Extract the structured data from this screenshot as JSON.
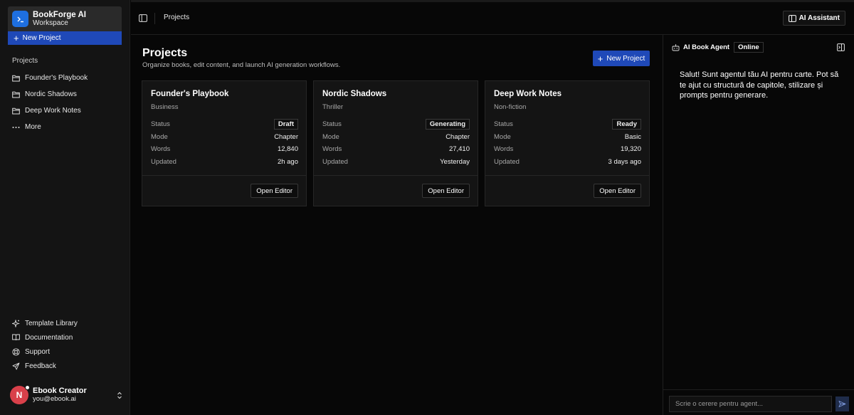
{
  "brand": {
    "title": "BookForge AI",
    "subtitle": "Workspace"
  },
  "sidebar": {
    "new_project_label": "New Project",
    "section_label": "Projects",
    "items": [
      {
        "label": "Founder's Playbook",
        "icon": "folder-icon"
      },
      {
        "label": "Nordic Shadows",
        "icon": "folder-icon"
      },
      {
        "label": "Deep Work Notes",
        "icon": "folder-icon"
      },
      {
        "label": "More",
        "icon": "more-icon"
      }
    ],
    "bottom": [
      {
        "label": "Template Library",
        "icon": "sparkle-icon"
      },
      {
        "label": "Documentation",
        "icon": "book-icon"
      },
      {
        "label": "Support",
        "icon": "lifebuoy-icon"
      },
      {
        "label": "Feedback",
        "icon": "send-icon"
      }
    ],
    "user": {
      "initial": "N",
      "name": "Ebook Creator",
      "email": "you@ebook.ai"
    }
  },
  "topbar": {
    "breadcrumb": "Projects",
    "ai_assistant_label": "AI Assistant"
  },
  "main": {
    "title": "Projects",
    "subtitle": "Organize books, edit content, and launch AI generation workflows.",
    "new_project_label": "New Project",
    "row_labels": {
      "status": "Status",
      "mode": "Mode",
      "words": "Words",
      "updated": "Updated"
    },
    "open_editor_label": "Open Editor",
    "cards": [
      {
        "title": "Founder's Playbook",
        "category": "Business",
        "status": "Draft",
        "mode": "Chapter",
        "words": "12,840",
        "updated": "2h ago"
      },
      {
        "title": "Nordic Shadows",
        "category": "Thriller",
        "status": "Generating",
        "mode": "Chapter",
        "words": "27,410",
        "updated": "Yesterday"
      },
      {
        "title": "Deep Work Notes",
        "category": "Non-fiction",
        "status": "Ready",
        "mode": "Basic",
        "words": "19,320",
        "updated": "3 days ago"
      }
    ]
  },
  "agent": {
    "title": "AI Book Agent",
    "status": "Online",
    "message": "Salut! Sunt agentul tău AI pentru carte. Pot să te ajut cu structură de capitole, stilizare și prompts pentru generare.",
    "input_placeholder": "Scrie o cerere pentru agent..."
  },
  "colors": {
    "accent": "#1f49b8",
    "brand_logo": "#1e6fe0",
    "avatar": "#d9404a",
    "background": "#070707",
    "panel": "#141414"
  }
}
